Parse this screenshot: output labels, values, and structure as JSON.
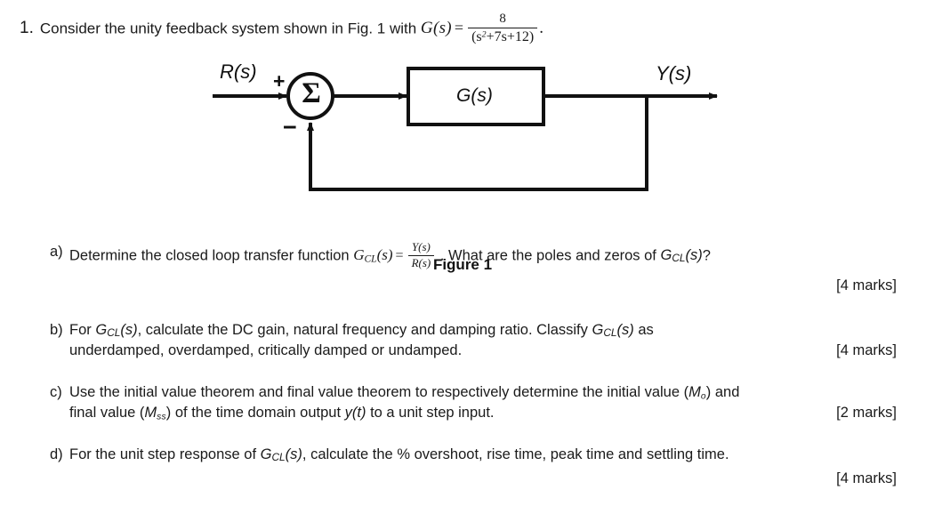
{
  "document": {
    "background_color": "#ffffff",
    "text_color": "#1a1a1a"
  },
  "stem": {
    "number": "1.",
    "text_before": "Consider the unity feedback system shown in Fig. 1 with",
    "function_symbol": "G",
    "function_arg": "(s)",
    "equals": "=",
    "numerator": "8",
    "denominator_open": "(s",
    "denominator_exp": "2",
    "denominator_rest": "+7s+12)",
    "period": "."
  },
  "diagram": {
    "input_label": "R(s)",
    "output_label": "Y(s)",
    "block_label": "G(s)",
    "plus_sign": "+",
    "minus_sign": "−",
    "summing_glyph": "Σ",
    "caption": "Figure 1",
    "line_color": "#111111"
  },
  "parts": [
    {
      "id": "a",
      "lead": "a)",
      "text_1": "Determine the closed loop transfer function",
      "symbol_g": "G",
      "symbol_cl": "CL",
      "symbol_arg": "(s)",
      "equals": "=",
      "frac_num": "Y(s)",
      "frac_den": "R(s)",
      "text_2": ".  What are the poles and zeros of",
      "text_3": "?",
      "marks": "[4 marks]"
    },
    {
      "id": "b",
      "lead": "b)",
      "text_1": "For",
      "text_2": ", calculate the DC gain, natural frequency and damping ratio. Classify",
      "text_3": "as",
      "text_4": "underdamped, overdamped, critically damped or undamped.",
      "marks": "[4 marks]"
    },
    {
      "id": "c",
      "lead": "c)",
      "text_1": "Use the initial value theorem and final value theorem to respectively determine the initial value (",
      "sym_m0": "M",
      "sym_m0_sub": "o",
      "text_2": ") and",
      "text_3": "final value (",
      "sym_mss": "M",
      "sym_mss_sub": "ss",
      "text_4": ") of the time domain output",
      "sym_yt": "y(t)",
      "text_5": "to a unit step input.",
      "marks": "[2 marks]"
    },
    {
      "id": "d",
      "lead": "d)",
      "text_1": "For the unit step response of",
      "text_2": ", calculate the % overshoot, rise time, peak time and settling time.",
      "marks": "[4 marks]"
    }
  ],
  "symbols": {
    "gcl_g": "G",
    "gcl_sub": "CL",
    "gcl_arg": "(s)"
  }
}
